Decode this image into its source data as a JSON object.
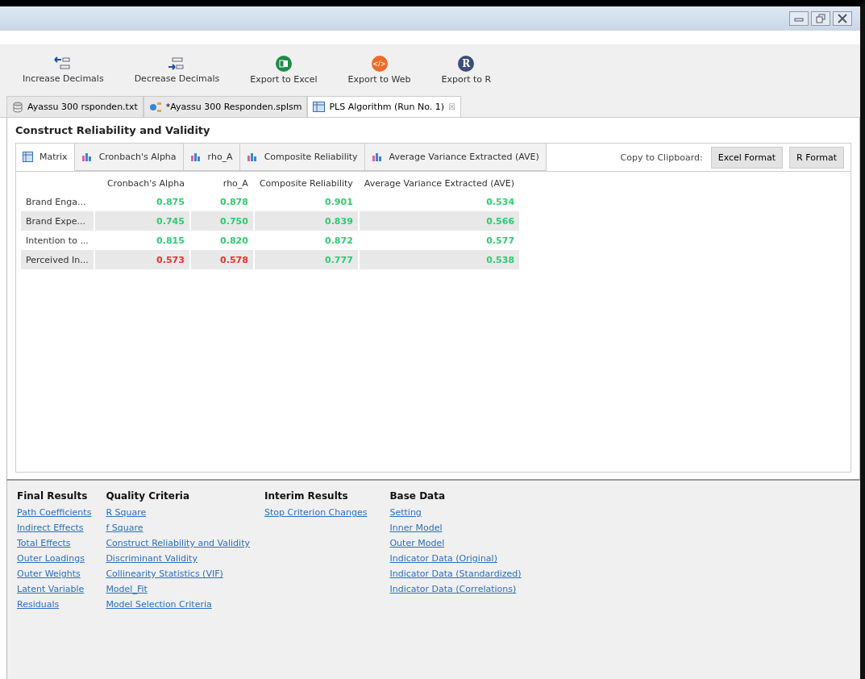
{
  "toolbar": [
    {
      "label": "Increase Decimals",
      "kind": "increase"
    },
    {
      "label": "Decrease Decimals",
      "kind": "decrease"
    },
    {
      "label": "Export to Excel",
      "kind": "excel"
    },
    {
      "label": "Export to Web",
      "kind": "web",
      "icon_text": "</>"
    },
    {
      "label": "Export to R",
      "kind": "r",
      "icon_text": "R"
    }
  ],
  "editor_tabs": [
    {
      "label": "Ayassu 300 rsponden.txt",
      "kind": "database",
      "selected": false
    },
    {
      "label": "*Ayassu 300 Responden.splsm",
      "kind": "model",
      "selected": false
    },
    {
      "label": "PLS Algorithm (Run No. 1)",
      "kind": "table",
      "selected": true,
      "close": "☒"
    }
  ],
  "section_title": "Construct Reliability and Validity",
  "view_tabs": [
    {
      "label": "Matrix",
      "kind": "table",
      "selected": true
    },
    {
      "label": "Cronbach's Alpha",
      "kind": "chart",
      "selected": false
    },
    {
      "label": "rho_A",
      "kind": "chart",
      "selected": false
    },
    {
      "label": "Composite Reliability",
      "kind": "chart",
      "selected": false
    },
    {
      "label": "Average Variance Extracted (AVE)",
      "kind": "chart",
      "selected": false
    }
  ],
  "clipboard": {
    "label": "Copy to Clipboard:",
    "buttons": [
      "Excel Format",
      "R Format"
    ]
  },
  "table": {
    "columns": [
      "Cronbach's Alpha",
      "rho_A",
      "Composite Reliability",
      "Average Variance Extracted (AVE)"
    ],
    "rows": [
      {
        "name": "Brand Enga...",
        "cells": [
          {
            "value": "0.875",
            "color": "#2ecc71"
          },
          {
            "value": "0.878",
            "color": "#2ecc71"
          },
          {
            "value": "0.901",
            "color": "#2ecc71"
          },
          {
            "value": "0.534",
            "color": "#2ecc71"
          }
        ]
      },
      {
        "name": "Brand Expe...",
        "cells": [
          {
            "value": "0.745",
            "color": "#2ecc71"
          },
          {
            "value": "0.750",
            "color": "#2ecc71"
          },
          {
            "value": "0.839",
            "color": "#2ecc71"
          },
          {
            "value": "0.566",
            "color": "#2ecc71"
          }
        ]
      },
      {
        "name": "Intention to ...",
        "cells": [
          {
            "value": "0.815",
            "color": "#2ecc71"
          },
          {
            "value": "0.820",
            "color": "#2ecc71"
          },
          {
            "value": "0.872",
            "color": "#2ecc71"
          },
          {
            "value": "0.577",
            "color": "#2ecc71"
          }
        ]
      },
      {
        "name": "Perceived In...",
        "cells": [
          {
            "value": "0.573",
            "color": "#e8312f"
          },
          {
            "value": "0.578",
            "color": "#e8312f"
          },
          {
            "value": "0.777",
            "color": "#2ecc71"
          },
          {
            "value": "0.538",
            "color": "#2ecc71"
          }
        ]
      }
    ]
  },
  "result_groups": [
    {
      "title": "Final Results",
      "links": [
        "Path Coefficients",
        "Indirect Effects",
        "Total Effects",
        "Outer Loadings",
        "Outer Weights",
        "Latent Variable",
        "Residuals"
      ]
    },
    {
      "title": "Quality Criteria",
      "links": [
        "R Square",
        "f Square",
        "Construct Reliability and Validity",
        "Discriminant Validity",
        "Collinearity Statistics (VIF)",
        "Model_Fit",
        "Model Selection Criteria"
      ]
    },
    {
      "title": "Interim Results",
      "links": [
        "Stop Criterion Changes"
      ]
    },
    {
      "title": "Base Data",
      "links": [
        "Setting",
        "Inner Model",
        "Outer Model",
        "Indicator Data (Original)",
        "Indicator Data (Standardized)",
        "Indicator Data (Correlations)"
      ]
    }
  ]
}
